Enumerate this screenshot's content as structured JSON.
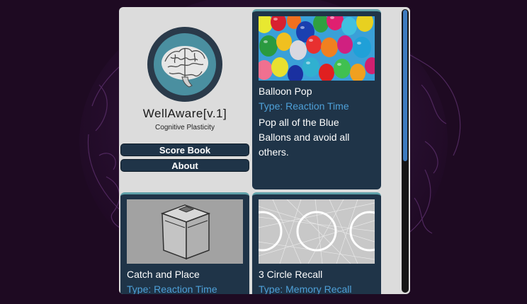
{
  "app": {
    "title": "WellAware[v.1]",
    "subtitle": "Cognitive Plasticity"
  },
  "nav": {
    "score_book": "Score Book",
    "about": "About"
  },
  "games": [
    {
      "name": "Balloon Pop",
      "type": "Type: Reaction Time",
      "description": "Pop all of the Blue Ballons and avoid all others.",
      "thumbnail_icon": "balloons-image"
    },
    {
      "name": "Catch and Place",
      "type": "Type: Reaction Time",
      "description": "",
      "thumbnail_icon": "box-image"
    },
    {
      "name": "3 Circle Recall",
      "type": "Type: Memory Recall",
      "description": "",
      "thumbnail_icon": "circles-image"
    }
  ],
  "colors": {
    "background": "#1e0a22",
    "panel": "#dcdcdc",
    "card": "#1f3448",
    "card_border": "#5fa1a9",
    "type_text": "#4ea0d8",
    "scroll_thumb": "#3d7bbf"
  },
  "scroll": {
    "position_fraction": 0
  }
}
